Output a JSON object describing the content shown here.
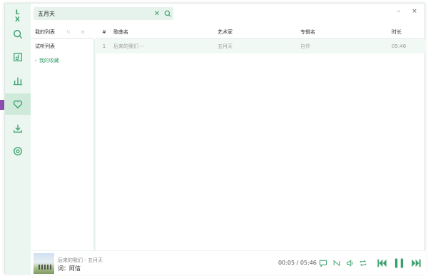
{
  "app": {
    "logo": "L X",
    "accent": "#3aa06c"
  },
  "rail": {
    "items": [
      {
        "icon": "search-icon",
        "name": "search"
      },
      {
        "icon": "song-list-icon",
        "name": "song-list"
      },
      {
        "icon": "leaderboard-icon",
        "name": "leaderboard"
      },
      {
        "icon": "heart-icon",
        "name": "my-list",
        "active": true
      },
      {
        "icon": "download-icon",
        "name": "download"
      },
      {
        "icon": "settings-icon",
        "name": "settings"
      }
    ]
  },
  "search": {
    "value": "五月天",
    "clear_label": "✕"
  },
  "window_controls": {
    "minimize": "–",
    "close": "×"
  },
  "lists": {
    "header": "我的列表",
    "items": [
      {
        "label": "试听列表"
      },
      {
        "label": "我的收藏",
        "caret": "›",
        "active": true
      }
    ]
  },
  "table": {
    "headers": {
      "num": "#",
      "name": "歌曲名",
      "artist": "艺术家",
      "album": "专辑名",
      "time": "时长"
    },
    "rows": [
      {
        "num": "1",
        "name": "后来的我们",
        "artist": "五月天",
        "album": "自传",
        "time": "05:46"
      }
    ]
  },
  "player": {
    "title": "后来的我们 - 五月天",
    "lyric": "词：阿信",
    "time": "00:05 / 05:46"
  }
}
